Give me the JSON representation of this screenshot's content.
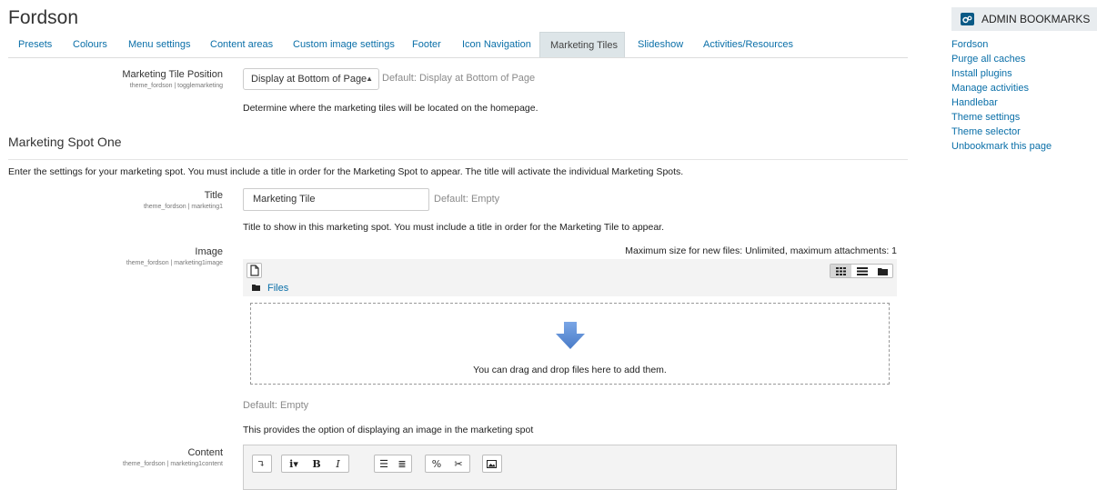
{
  "page": {
    "title": "Fordson"
  },
  "tabs": [
    {
      "label": "Presets"
    },
    {
      "label": "Colours"
    },
    {
      "label": "Menu settings"
    },
    {
      "label": "Content areas"
    },
    {
      "label": "Custom image settings"
    },
    {
      "label": "Footer"
    },
    {
      "label": "Icon Navigation"
    },
    {
      "label": "Marketing Tiles",
      "active": true
    },
    {
      "label": "Slideshow"
    },
    {
      "label": "Activities/Resources"
    }
  ],
  "position_setting": {
    "label": "Marketing Tile Position",
    "sublabel": "theme_fordson | togglemarketing",
    "value": "Display at Bottom of Page",
    "default": "Default: Display at Bottom of Page",
    "description": "Determine where the marketing tiles will be located on the homepage."
  },
  "section": {
    "title": "Marketing Spot One",
    "intro": "Enter the settings for your marketing spot. You must include a title in order for the Marketing Spot to appear. The title will activate the individual Marketing Spots."
  },
  "title_setting": {
    "label": "Title",
    "sublabel": "theme_fordson | marketing1",
    "value": "Marketing Tile",
    "default": "Default: Empty",
    "description": "Title to show in this marketing spot. You must include a title in order for the Marketing Tile to appear."
  },
  "image_setting": {
    "label": "Image",
    "sublabel": "theme_fordson | marketing1image",
    "max_size": "Maximum size for new files: Unlimited, maximum attachments: 1",
    "folder": "Files",
    "drop_text": "You can drag and drop files here to add them.",
    "default": "Default: Empty",
    "description": "This provides the option of displaying an image in the marketing spot"
  },
  "content_setting": {
    "label": "Content",
    "sublabel": "theme_fordson | marketing1content"
  },
  "sidebar": {
    "title": "ADMIN BOOKMARKS",
    "links": [
      {
        "label": "Fordson"
      },
      {
        "label": "Purge all caches"
      },
      {
        "label": "Install plugins"
      },
      {
        "label": "Manage activities"
      },
      {
        "label": "Handlebar"
      },
      {
        "label": "Theme settings"
      },
      {
        "label": "Theme selector"
      },
      {
        "label": "Unbookmark this page"
      }
    ]
  },
  "colors": {
    "link": "#0a6fa8",
    "active_tab_bg": "#dde5e8",
    "arrow": "#5b8fd6"
  }
}
